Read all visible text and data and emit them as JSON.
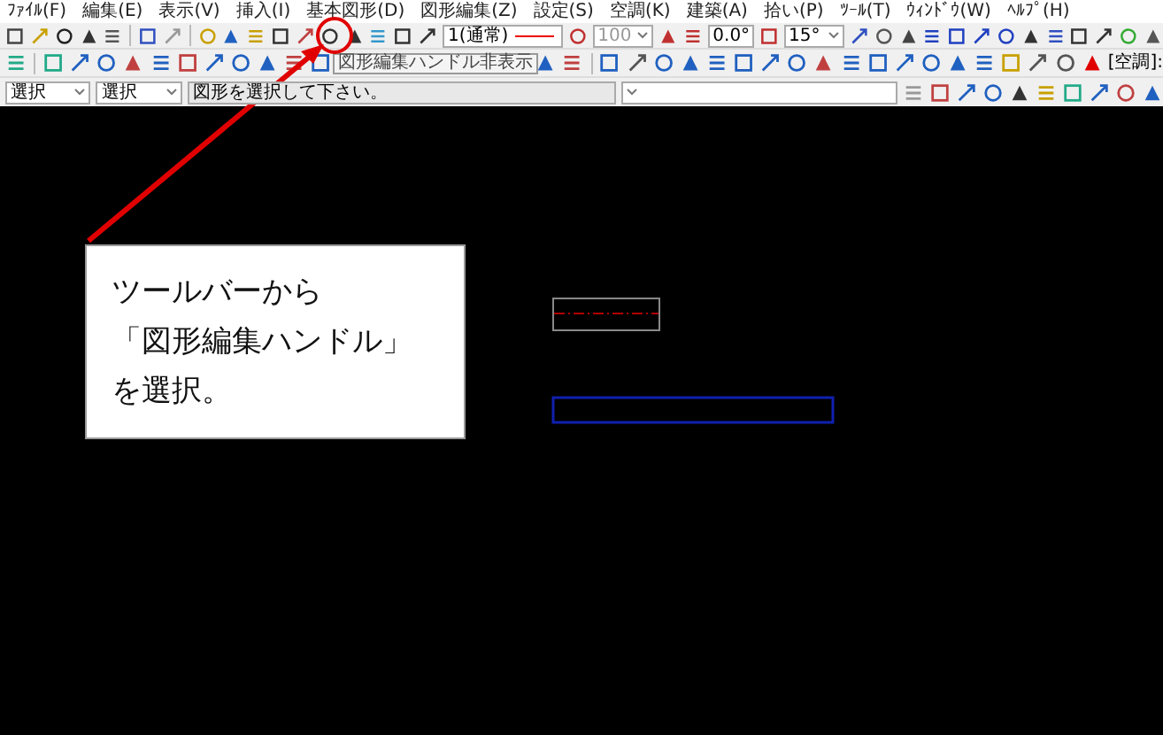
{
  "menu": [
    {
      "label": "ﾌｧｲﾙ(F)"
    },
    {
      "label": "編集(E)"
    },
    {
      "label": "表示(V)"
    },
    {
      "label": "挿入(I)"
    },
    {
      "label": "基本図形(D)"
    },
    {
      "label": "図形編集(Z)"
    },
    {
      "label": "設定(S)"
    },
    {
      "label": "空調(K)"
    },
    {
      "label": "建築(A)"
    },
    {
      "label": "拾い(P)"
    },
    {
      "label": "ﾂｰﾙ(T)"
    },
    {
      "label": "ｳｨﾝﾄﾞｳ(W)"
    },
    {
      "label": "ﾍﾙﾌﾟ(H)"
    }
  ],
  "toolbar": {
    "line_type": "1(通常)",
    "scale": "100",
    "angle": "0.0°",
    "snap_angle": "15°",
    "layer_label": "[空調]:"
  },
  "tooltip": "図形編集ハンドル非表示",
  "command_bar": {
    "mode_1": "選択",
    "mode_2": "選択",
    "prompt": "図形を選択して下さい。"
  },
  "callout": {
    "lines": [
      "ツールバーから",
      "「図形編集ハンドル」",
      "を選択。"
    ]
  }
}
